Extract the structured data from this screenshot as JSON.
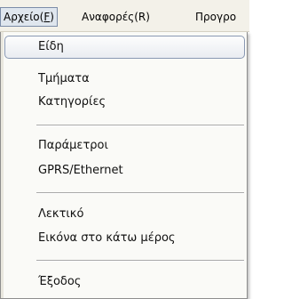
{
  "menubar": {
    "items": [
      {
        "label_main": "Αρχείο(",
        "label_key": "F",
        "label_end": ")"
      },
      {
        "label": "Αναφορές(R)"
      },
      {
        "label": "Προγρο"
      }
    ]
  },
  "dropdown": {
    "group1": [
      "Είδη",
      "Τμήματα",
      "Κατηγορίες"
    ],
    "group2": [
      "Παράμετροι",
      "GPRS/Ethernet"
    ],
    "group3": [
      "Λεκτικό",
      "Εικόνα στο κάτω μέρος"
    ],
    "group4": [
      "Έξοδος"
    ]
  }
}
